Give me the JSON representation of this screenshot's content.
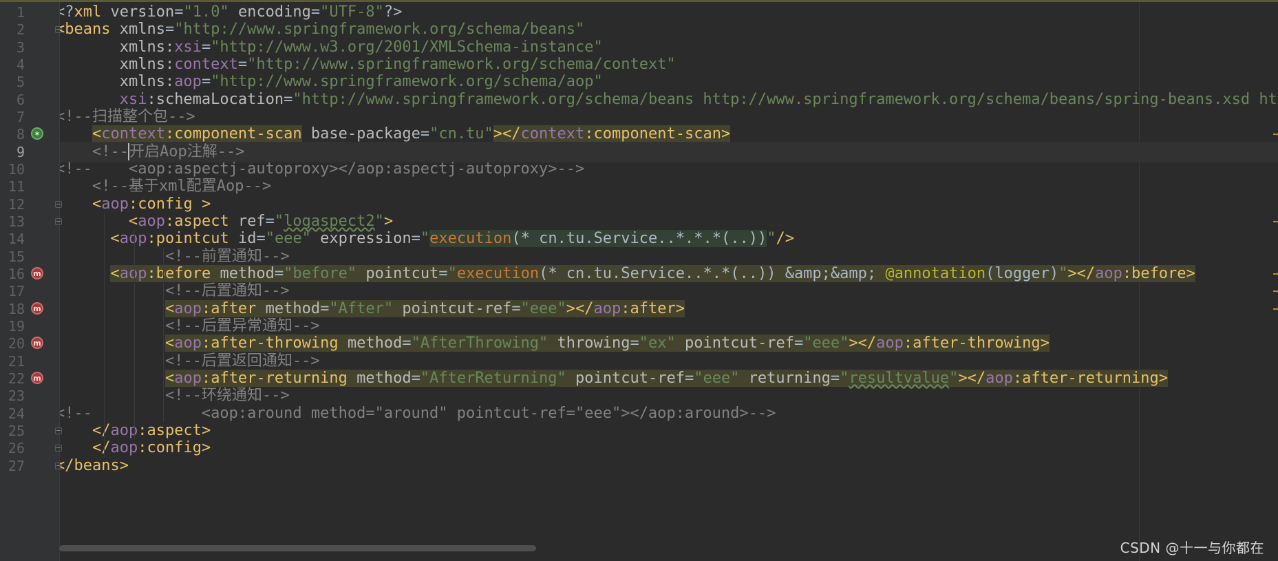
{
  "editor": {
    "language": "xml",
    "current_line": 9
  },
  "lines": [
    {
      "n": "1",
      "tokens": [
        [
          "p",
          "<?"
        ],
        [
          "t",
          "xml"
        ],
        [
          "a",
          " version"
        ],
        [
          "p",
          "="
        ],
        [
          "s",
          "\"1.0\""
        ],
        [
          "a",
          " encoding"
        ],
        [
          "p",
          "="
        ],
        [
          "s",
          "\"UTF-8\""
        ],
        [
          "p",
          "?>"
        ]
      ]
    },
    {
      "n": "2",
      "tokens": [
        [
          "t",
          "<beans"
        ],
        [
          "a",
          " xmlns"
        ],
        [
          "p",
          "="
        ],
        [
          "s",
          "\"http://www.springframework.org/schema/beans\""
        ]
      ]
    },
    {
      "n": "3",
      "tokens": [
        [
          "a",
          "       xmlns:"
        ],
        [
          "ns",
          "xsi"
        ],
        [
          "p",
          "="
        ],
        [
          "s",
          "\"http://www.w3.org/2001/XMLSchema-instance\""
        ]
      ]
    },
    {
      "n": "4",
      "tokens": [
        [
          "a",
          "       xmlns:"
        ],
        [
          "ns",
          "context"
        ],
        [
          "p",
          "="
        ],
        [
          "s",
          "\"http://www.springframework.org/schema/context\""
        ]
      ]
    },
    {
      "n": "5",
      "tokens": [
        [
          "a",
          "       xmlns:"
        ],
        [
          "ns",
          "aop"
        ],
        [
          "p",
          "="
        ],
        [
          "s",
          "\"http://www.springframework.org/schema/aop\""
        ]
      ]
    },
    {
      "n": "6",
      "tokens": [
        [
          "ns",
          "       xsi"
        ],
        [
          "a",
          ":schemaLocation"
        ],
        [
          "p",
          "="
        ],
        [
          "s",
          "\"http://www.springframework.org/schema/beans http://www.springframework.org/schema/beans/spring-beans.xsd http"
        ]
      ]
    },
    {
      "n": "7",
      "tokens": [
        [
          "c",
          "<!--扫描整个包-->"
        ]
      ]
    },
    {
      "n": "8",
      "tokens": [
        [
          "p",
          "    "
        ],
        [
          "t hl-tag",
          "<"
        ],
        [
          "ns hl-tag",
          "context"
        ],
        [
          "t hl-tag",
          ":component-scan"
        ],
        [
          "a",
          " base-package"
        ],
        [
          "p",
          "="
        ],
        [
          "s",
          "\"cn.tu\""
        ],
        [
          "t hl-tag",
          "></"
        ],
        [
          "ns hl-tag",
          "context"
        ],
        [
          "t hl-tag",
          ":component-scan>"
        ]
      ]
    },
    {
      "n": "9",
      "tokens": [
        [
          "c",
          "    <!--"
        ],
        [
          "c caret",
          ""
        ],
        [
          "c",
          "开启Aop注解-->"
        ]
      ]
    },
    {
      "n": "10",
      "tokens": [
        [
          "c",
          "<!--    <aop:aspectj-autoproxy></aop:aspectj-autoproxy>-->"
        ]
      ]
    },
    {
      "n": "11",
      "tokens": [
        [
          "c",
          "    <!--基于xml配置Aop-->"
        ]
      ]
    },
    {
      "n": "12",
      "tokens": [
        [
          "p",
          "    "
        ],
        [
          "t",
          "<"
        ],
        [
          "ns",
          "aop"
        ],
        [
          "t",
          ":config >"
        ]
      ]
    },
    {
      "n": "13",
      "tokens": [
        [
          "p",
          "        "
        ],
        [
          "t",
          "<"
        ],
        [
          "ns",
          "aop"
        ],
        [
          "t",
          ":aspect"
        ],
        [
          "a",
          " ref"
        ],
        [
          "p",
          "="
        ],
        [
          "s",
          "\""
        ],
        [
          "s squig",
          "logaspect2"
        ],
        [
          "s",
          "\""
        ],
        [
          "t",
          ">"
        ]
      ]
    },
    {
      "n": "14",
      "tokens": [
        [
          "p",
          "      "
        ],
        [
          "t",
          "<"
        ],
        [
          "ns",
          "aop"
        ],
        [
          "t",
          ":pointcut"
        ],
        [
          "a",
          " id"
        ],
        [
          "p",
          "="
        ],
        [
          "s",
          "\"eee\""
        ],
        [
          "a",
          " expression"
        ],
        [
          "p",
          "="
        ],
        [
          "s",
          "\""
        ],
        [
          "o hl-exp",
          "execution"
        ],
        [
          "p hl-exp",
          "(* cn.tu.Service..*.*.*(..))"
        ],
        [
          "s",
          "\""
        ],
        [
          "t",
          "/>"
        ]
      ]
    },
    {
      "n": "15",
      "tokens": [
        [
          "c",
          "            <!--前置通知-->"
        ]
      ]
    },
    {
      "n": "16",
      "tokens": [
        [
          "p",
          "      "
        ],
        [
          "t hl-tag",
          "<"
        ],
        [
          "ns hl-tag",
          "aop"
        ],
        [
          "t hl-tag",
          ":before"
        ],
        [
          "a hl-tag",
          " method"
        ],
        [
          "p hl-tag",
          "="
        ],
        [
          "s hl-tag",
          "\"before\""
        ],
        [
          "a hl-tag",
          " pointcut"
        ],
        [
          "p hl-tag",
          "="
        ],
        [
          "s hl-tag",
          "\""
        ],
        [
          "o hl-tag",
          "execution"
        ],
        [
          "p hl-tag",
          "(* cn.tu.Service..*.*(..)) &amp;&amp; "
        ],
        [
          "an hl-tag",
          "@annotation"
        ],
        [
          "p hl-tag",
          "(logger)"
        ],
        [
          "s hl-tag",
          "\""
        ],
        [
          "t hl-tag",
          "></"
        ],
        [
          "ns hl-tag",
          "aop"
        ],
        [
          "t hl-tag",
          ":before>"
        ]
      ]
    },
    {
      "n": "17",
      "tokens": [
        [
          "c",
          "            <!--后置通知-->"
        ]
      ]
    },
    {
      "n": "18",
      "tokens": [
        [
          "p",
          "            "
        ],
        [
          "t hl-tag",
          "<"
        ],
        [
          "ns hl-tag",
          "aop"
        ],
        [
          "t hl-tag",
          ":after"
        ],
        [
          "a hl-tag",
          " method"
        ],
        [
          "p hl-tag",
          "="
        ],
        [
          "s hl-tag",
          "\"After\""
        ],
        [
          "a hl-tag",
          " pointcut-ref"
        ],
        [
          "p hl-tag",
          "="
        ],
        [
          "s hl-tag",
          "\"eee\""
        ],
        [
          "t hl-tag",
          "></"
        ],
        [
          "ns hl-tag",
          "aop"
        ],
        [
          "t hl-tag",
          ":after>"
        ]
      ]
    },
    {
      "n": "19",
      "tokens": [
        [
          "c",
          "            <!--后置异常通知-->"
        ]
      ]
    },
    {
      "n": "20",
      "tokens": [
        [
          "p",
          "            "
        ],
        [
          "t hl-tag",
          "<"
        ],
        [
          "ns hl-tag",
          "aop"
        ],
        [
          "t hl-tag",
          ":after-throwing"
        ],
        [
          "a hl-tag",
          " method"
        ],
        [
          "p hl-tag",
          "="
        ],
        [
          "s hl-tag",
          "\"AfterThrowing\""
        ],
        [
          "a hl-tag",
          " throwing"
        ],
        [
          "p hl-tag",
          "="
        ],
        [
          "s hl-tag",
          "\"ex\""
        ],
        [
          "a hl-tag",
          " pointcut-ref"
        ],
        [
          "p hl-tag",
          "="
        ],
        [
          "s hl-tag",
          "\"eee\""
        ],
        [
          "t hl-tag",
          "></"
        ],
        [
          "ns hl-tag",
          "aop"
        ],
        [
          "t hl-tag",
          ":after-throwing>"
        ]
      ]
    },
    {
      "n": "21",
      "tokens": [
        [
          "c",
          "            <!--后置返回通知-->"
        ]
      ]
    },
    {
      "n": "22",
      "tokens": [
        [
          "p",
          "            "
        ],
        [
          "t hl-tag",
          "<"
        ],
        [
          "ns hl-tag",
          "aop"
        ],
        [
          "t hl-tag",
          ":after-returning"
        ],
        [
          "a hl-tag",
          " method"
        ],
        [
          "p hl-tag",
          "="
        ],
        [
          "s hl-tag",
          "\"AfterReturning\""
        ],
        [
          "a hl-tag",
          " pointcut-ref"
        ],
        [
          "p hl-tag",
          "="
        ],
        [
          "s hl-tag",
          "\"eee\""
        ],
        [
          "a hl-tag",
          " returning"
        ],
        [
          "p hl-tag",
          "="
        ],
        [
          "s hl-tag",
          "\""
        ],
        [
          "s hl-tag squig",
          "resultvalue"
        ],
        [
          "s hl-tag",
          "\""
        ],
        [
          "t hl-tag",
          "></"
        ],
        [
          "ns hl-tag",
          "aop"
        ],
        [
          "t hl-tag",
          ":after-returning>"
        ]
      ]
    },
    {
      "n": "23",
      "tokens": [
        [
          "c",
          "            <!--环绕通知-->"
        ]
      ]
    },
    {
      "n": "24",
      "tokens": [
        [
          "c",
          "<!--            <aop:around method=\"around\" pointcut-ref=\"eee\"></aop:around>-->"
        ]
      ]
    },
    {
      "n": "25",
      "tokens": [
        [
          "p",
          "    "
        ],
        [
          "t",
          "</"
        ],
        [
          "ns",
          "aop"
        ],
        [
          "t",
          ":aspect>"
        ]
      ]
    },
    {
      "n": "26",
      "tokens": [
        [
          "p",
          "    "
        ],
        [
          "t",
          "</"
        ],
        [
          "ns",
          "aop"
        ],
        [
          "t",
          ":config>"
        ]
      ]
    },
    {
      "n": "27",
      "tokens": [
        [
          "t",
          "</beans>"
        ]
      ]
    }
  ],
  "gutter_icons": [
    {
      "line": "8",
      "icon": "spring-scan-icon",
      "glyph": "✶"
    },
    {
      "line": "16",
      "icon": "advice-method-icon",
      "glyph": "m"
    },
    {
      "line": "18",
      "icon": "advice-method-icon",
      "glyph": "m"
    },
    {
      "line": "20",
      "icon": "advice-method-icon",
      "glyph": "m"
    },
    {
      "line": "22",
      "icon": "advice-method-icon",
      "glyph": "m"
    }
  ],
  "fold_markers": [
    "2",
    "12",
    "13",
    "25",
    "26",
    "27"
  ],
  "watermark": "CSDN @十一与你都在",
  "colors": {
    "background": "#2b2b2b",
    "tag": "#e8bf6a",
    "string": "#6a8759",
    "namespace": "#9876aa",
    "comment": "#808080",
    "keyword": "#cc7832",
    "annotation": "#bbb529"
  }
}
